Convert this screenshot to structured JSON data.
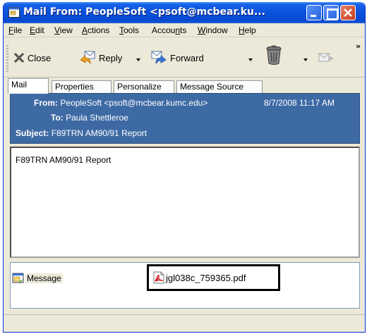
{
  "window": {
    "title": "Mail From: PeopleSoft <psoft@mcbear.ku..."
  },
  "menu": [
    {
      "label": "File",
      "accel": "F",
      "rest": "ile"
    },
    {
      "label": "Edit",
      "accel": "E",
      "rest": "dit"
    },
    {
      "label": "View",
      "accel": "V",
      "rest": "iew"
    },
    {
      "label": "Actions",
      "accel": "A",
      "rest": "ctions"
    },
    {
      "label": "Tools",
      "accel": "T",
      "rest": "ools"
    },
    {
      "label": "Accounts",
      "pre": "Accou",
      "accel": "n",
      "rest": "ts"
    },
    {
      "label": "Window",
      "accel": "W",
      "rest": "indow"
    },
    {
      "label": "Help",
      "accel": "H",
      "rest": "elp"
    }
  ],
  "toolbar": {
    "close_label": "Close",
    "reply_label": "Reply",
    "forward_label": "Forward",
    "more": "»"
  },
  "tabs": [
    "Mail",
    "Properties",
    "Personalize",
    "Message Source"
  ],
  "header": {
    "from_label": "From:",
    "from_value": "PeopleSoft <psoft@mcbear.kumc.edu>",
    "date": "8/7/2008 11:17 AM",
    "to_label": "To:",
    "to_value": "Paula Shettleroe",
    "subject_label": "Subject:",
    "subject_value": "F89TRN  AM90/91 Report"
  },
  "body": {
    "text": "F89TRN  AM90/91 Report"
  },
  "attachments": {
    "message_label": "Message",
    "pdf_label": "jgl038c_759365.pdf"
  },
  "colors": {
    "titlebar": "#0a52dc",
    "header_bg": "#3e6aa4",
    "window_bg": "#ece9d8"
  }
}
